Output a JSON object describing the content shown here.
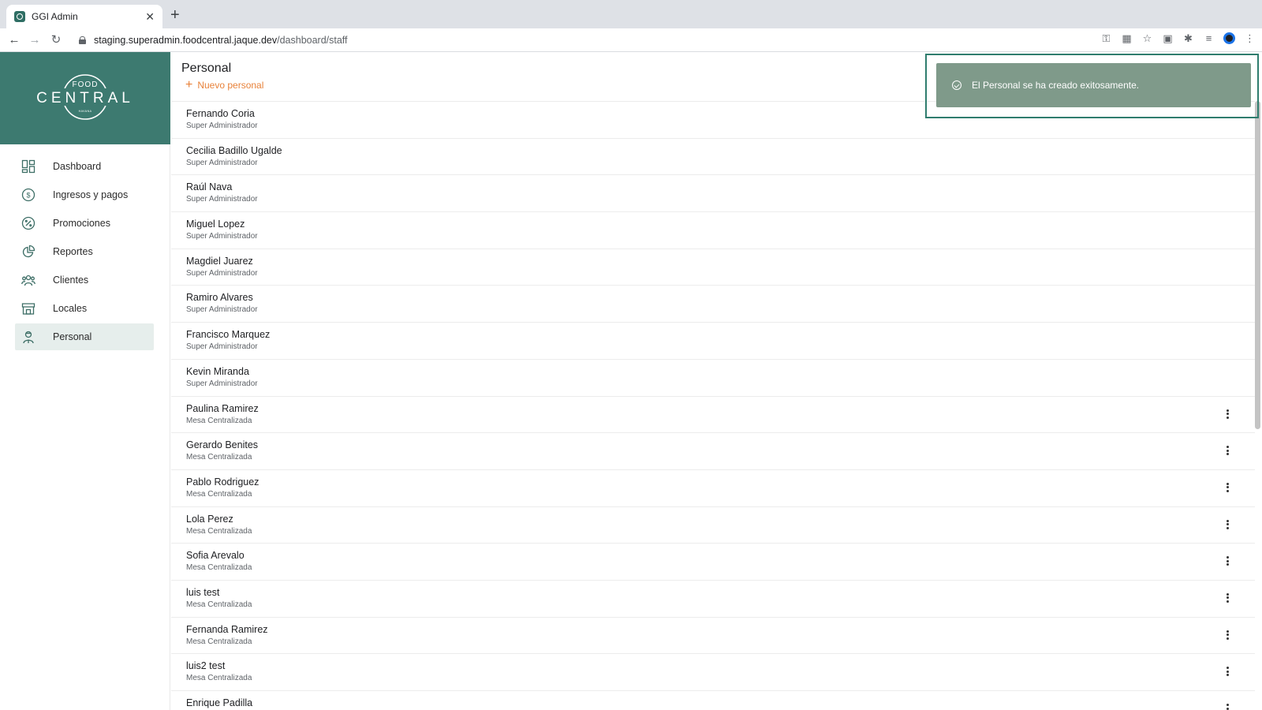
{
  "browser": {
    "tab_title": "GGI Admin",
    "tab_close": "✕",
    "new_tab": "+",
    "url_host": "staging.superadmin.foodcentral.jaque.dev",
    "url_path": "/dashboard/staff"
  },
  "brand": {
    "small_top": "FOOD",
    "main": "CENTRAL",
    "small_bottom": "HAVANA"
  },
  "sidebar": {
    "items": [
      {
        "label": "Dashboard",
        "icon": "dashboard-icon"
      },
      {
        "label": "Ingresos y pagos",
        "icon": "dollar-icon"
      },
      {
        "label": "Promociones",
        "icon": "percent-icon"
      },
      {
        "label": "Reportes",
        "icon": "pie-chart-icon"
      },
      {
        "label": "Clientes",
        "icon": "users-icon"
      },
      {
        "label": "Locales",
        "icon": "store-icon"
      },
      {
        "label": "Personal",
        "icon": "staff-icon",
        "active": true
      }
    ]
  },
  "page": {
    "title": "Personal",
    "new_button": "Nuevo personal",
    "new_button_icon": "+"
  },
  "staff": [
    {
      "name": "Fernando Coria",
      "role": "Super Administrador",
      "menu": false
    },
    {
      "name": "Cecilia Badillo Ugalde",
      "role": "Super Administrador",
      "menu": false
    },
    {
      "name": "Raúl Nava",
      "role": "Super Administrador",
      "menu": false
    },
    {
      "name": "Miguel Lopez",
      "role": "Super Administrador",
      "menu": false
    },
    {
      "name": "Magdiel Juarez",
      "role": "Super Administrador",
      "menu": false
    },
    {
      "name": "Ramiro Alvares",
      "role": "Super Administrador",
      "menu": false
    },
    {
      "name": "Francisco Marquez",
      "role": "Super Administrador",
      "menu": false
    },
    {
      "name": "Kevin Miranda",
      "role": "Super Administrador",
      "menu": false
    },
    {
      "name": "Paulina Ramirez",
      "role": "Mesa Centralizada",
      "menu": true
    },
    {
      "name": "Gerardo Benites",
      "role": "Mesa Centralizada",
      "menu": true
    },
    {
      "name": "Pablo Rodriguez",
      "role": "Mesa Centralizada",
      "menu": true
    },
    {
      "name": "Lola Perez",
      "role": "Mesa Centralizada",
      "menu": true
    },
    {
      "name": "Sofia Arevalo",
      "role": "Mesa Centralizada",
      "menu": true
    },
    {
      "name": "luis test",
      "role": "Mesa Centralizada",
      "menu": true
    },
    {
      "name": "Fernanda Ramirez",
      "role": "Mesa Centralizada",
      "menu": true
    },
    {
      "name": "luis2 test",
      "role": "Mesa Centralizada",
      "menu": true
    },
    {
      "name": "Enrique Padilla",
      "role": "",
      "menu": true
    }
  ],
  "toast": {
    "message": "El Personal se ha creado exitosamente."
  },
  "colors": {
    "brand": "#3d7a70",
    "accent": "#e8823a",
    "toast": "#7f9a8a",
    "active_nav": "#e6eeec"
  }
}
